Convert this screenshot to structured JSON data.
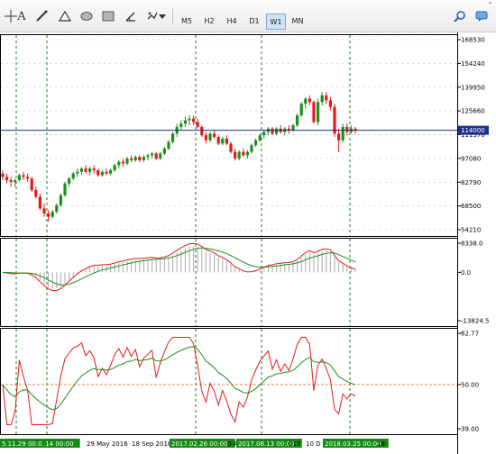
{
  "toolbar": {
    "tools": [
      {
        "name": "crosshair-icon"
      },
      {
        "name": "text-icon",
        "glyph": "A"
      },
      {
        "name": "trendline-icon"
      },
      {
        "name": "triangle-icon"
      },
      {
        "name": "ellipse-icon"
      },
      {
        "name": "rectangle-icon"
      },
      {
        "name": "angle-icon"
      },
      {
        "name": "shapes-menu-icon"
      }
    ],
    "timeframes": [
      "M5",
      "H2",
      "H4",
      "D1",
      "W1",
      "MN"
    ],
    "active_timeframe": "W1",
    "scroll_glyph": "⌃"
  },
  "chart_data": {
    "type": "candlestick",
    "colors": {
      "up": "#1d8f1d",
      "down": "#e21b1b",
      "bid_line": "#1c2f8c",
      "ma_main": "#e21b1b",
      "signal": "#1d8f1d",
      "histogram": "#a9a9a9",
      "level_line": "#e2784a",
      "grid": "#1a7f1a"
    },
    "current_price": 114000,
    "current_price_label": "114000",
    "main": {
      "y_ticks": [
        "168530",
        "154240",
        "139950",
        "125660",
        "111370",
        "97080",
        "82790",
        "68500",
        "54210"
      ],
      "ylim": [
        54210,
        168530
      ]
    },
    "macd": {
      "ticks": [
        "8338.0",
        "0.0",
        "-13824.5"
      ],
      "ylim": [
        -13824.5,
        8338.0
      ]
    },
    "rsi": {
      "ticks": [
        "62.77",
        "50.00",
        "39.00"
      ],
      "ylim": [
        39.0,
        62.77
      ],
      "level": 50
    },
    "date_labels": [
      {
        "text": "5.11.29 00:00",
        "highlight": true
      },
      {
        "text": ".14 00:00",
        "highlight": true
      },
      {
        "text": "29 May 2016",
        "highlight": false
      },
      {
        "text": "18 Sep 2016",
        "highlight": false
      },
      {
        "text": "2017.02.26 00:00",
        "highlight": true
      },
      {
        "text": "0 A",
        "highlight": false
      },
      {
        "text": "2017.08.13 00:00",
        "highlight": true
      },
      {
        "text": "017",
        "highlight": false
      },
      {
        "text": "10 D",
        "highlight": false
      },
      {
        "text": "2018.03.25 00:00",
        "highlight": true
      },
      {
        "text": "18",
        "highlight": false
      }
    ],
    "candles": [
      [
        88000,
        90000,
        84000,
        86000
      ],
      [
        86000,
        88000,
        82000,
        84000
      ],
      [
        84000,
        86000,
        80000,
        83000
      ],
      [
        83000,
        85000,
        80000,
        84000
      ],
      [
        84000,
        88000,
        83000,
        87000
      ],
      [
        87000,
        89000,
        84000,
        86000
      ],
      [
        86000,
        88000,
        83000,
        85000
      ],
      [
        85000,
        86000,
        77000,
        78000
      ],
      [
        78000,
        80000,
        73000,
        74000
      ],
      [
        74000,
        76000,
        66000,
        67000
      ],
      [
        67000,
        70000,
        62000,
        64000
      ],
      [
        64000,
        66000,
        59000,
        62000
      ],
      [
        62000,
        66000,
        61000,
        65000
      ],
      [
        65000,
        70000,
        64000,
        69000
      ],
      [
        69000,
        76000,
        68000,
        75000
      ],
      [
        75000,
        83000,
        74000,
        82000
      ],
      [
        82000,
        86000,
        80000,
        85000
      ],
      [
        85000,
        89000,
        84000,
        88000
      ],
      [
        88000,
        91000,
        86000,
        89000
      ],
      [
        89000,
        92000,
        87000,
        91000
      ],
      [
        91000,
        93000,
        88000,
        89000
      ],
      [
        89000,
        92000,
        87000,
        91000
      ],
      [
        91000,
        93000,
        88000,
        90000
      ],
      [
        90000,
        91000,
        86000,
        87000
      ],
      [
        87000,
        90000,
        86000,
        89000
      ],
      [
        89000,
        91000,
        87000,
        88000
      ],
      [
        88000,
        91000,
        87000,
        90000
      ],
      [
        90000,
        94000,
        89000,
        93000
      ],
      [
        93000,
        96000,
        91000,
        95000
      ],
      [
        95000,
        97000,
        92000,
        94000
      ],
      [
        94000,
        98000,
        93000,
        97000
      ],
      [
        97000,
        99000,
        95000,
        96000
      ],
      [
        96000,
        99000,
        95000,
        98000
      ],
      [
        98000,
        99000,
        95000,
        96000
      ],
      [
        96000,
        99000,
        95000,
        98000
      ],
      [
        98000,
        100000,
        96000,
        99000
      ],
      [
        99000,
        101000,
        97000,
        100000
      ],
      [
        100000,
        101000,
        96000,
        97000
      ],
      [
        97000,
        101000,
        96000,
        100000
      ],
      [
        100000,
        104000,
        99000,
        103000
      ],
      [
        103000,
        108000,
        102000,
        107000
      ],
      [
        107000,
        113000,
        106000,
        112000
      ],
      [
        112000,
        118000,
        110000,
        116000
      ],
      [
        116000,
        120000,
        114000,
        118000
      ],
      [
        118000,
        122000,
        116000,
        120000
      ],
      [
        120000,
        123000,
        117000,
        121000
      ],
      [
        121000,
        123000,
        117000,
        119000
      ],
      [
        119000,
        121000,
        115000,
        116000
      ],
      [
        116000,
        117000,
        110000,
        111000
      ],
      [
        111000,
        113000,
        106000,
        108000
      ],
      [
        108000,
        113000,
        107000,
        112000
      ],
      [
        112000,
        114000,
        109000,
        110000
      ],
      [
        110000,
        111000,
        105000,
        106000
      ],
      [
        106000,
        110000,
        105000,
        109000
      ],
      [
        109000,
        111000,
        105000,
        106000
      ],
      [
        106000,
        107000,
        100000,
        101000
      ],
      [
        101000,
        103000,
        96000,
        97000
      ],
      [
        97000,
        102000,
        96000,
        101000
      ],
      [
        101000,
        103000,
        98000,
        99000
      ],
      [
        99000,
        102000,
        97000,
        101000
      ],
      [
        101000,
        106000,
        100000,
        105000
      ],
      [
        105000,
        109000,
        104000,
        108000
      ],
      [
        108000,
        112000,
        107000,
        111000
      ],
      [
        111000,
        114000,
        109000,
        113000
      ],
      [
        113000,
        116000,
        111000,
        115000
      ],
      [
        115000,
        116000,
        111000,
        112000
      ],
      [
        112000,
        116000,
        111000,
        115000
      ],
      [
        115000,
        117000,
        112000,
        113000
      ],
      [
        113000,
        116000,
        111000,
        115000
      ],
      [
        115000,
        117000,
        112000,
        114000
      ],
      [
        114000,
        118000,
        113000,
        117000
      ],
      [
        117000,
        124000,
        116000,
        123000
      ],
      [
        123000,
        131000,
        122000,
        130000
      ],
      [
        130000,
        134000,
        127000,
        133000
      ],
      [
        133000,
        135000,
        129000,
        131000
      ],
      [
        131000,
        132000,
        118000,
        119000
      ],
      [
        119000,
        133000,
        117000,
        131000
      ],
      [
        131000,
        137000,
        129000,
        135000
      ],
      [
        135000,
        137000,
        130000,
        132000
      ],
      [
        132000,
        134000,
        126000,
        128000
      ],
      [
        128000,
        130000,
        110000,
        112000
      ],
      [
        112000,
        115000,
        101000,
        108000
      ],
      [
        108000,
        118000,
        107000,
        116000
      ],
      [
        116000,
        118000,
        111000,
        113000
      ],
      [
        113000,
        117000,
        112000,
        115000
      ],
      [
        115000,
        116000,
        112000,
        114000
      ]
    ]
  }
}
